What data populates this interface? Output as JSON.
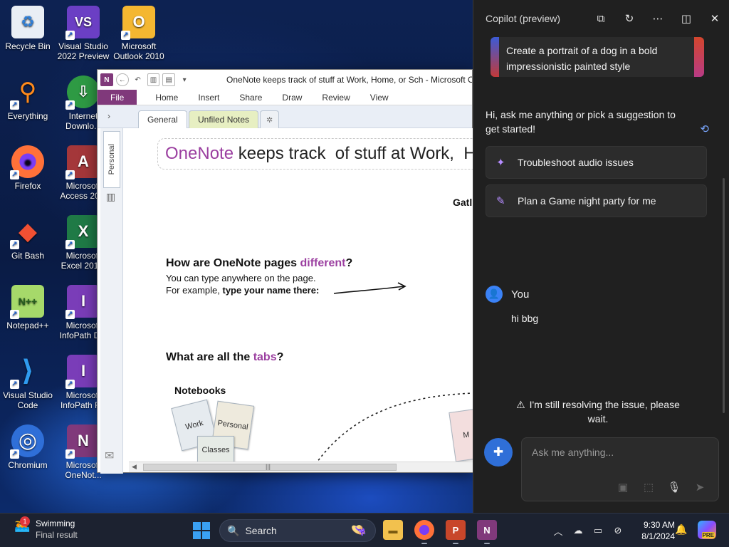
{
  "desktop": {
    "icons": [
      {
        "label": "Recycle Bin",
        "glyph": "♻",
        "bg": "#e9eef5",
        "fg": "#2f7fd8"
      },
      {
        "label": "Visual Studio 2022 Preview",
        "glyph": "VS",
        "bg": "#6b3fc4",
        "fg": "#ffffff"
      },
      {
        "label": "Microsoft Outlook 2010",
        "glyph": "O",
        "bg": "#f4b731",
        "fg": "#ffffff"
      },
      {
        "label": "Everything",
        "glyph": "⚲",
        "bg": "#1e2a48",
        "fg": "#ff8a1c"
      },
      {
        "label": "Internet Downlo...",
        "glyph": "⇩",
        "bg": "#2e9a44",
        "fg": "#ffffff"
      },
      {
        "label": "Firefox",
        "glyph": "●",
        "bg": "#ff7139",
        "fg": "#7a3df5"
      },
      {
        "label": "Microsoft Access 20...",
        "glyph": "A",
        "bg": "#a4373a",
        "fg": "#ffffff"
      },
      {
        "label": "Git Bash",
        "glyph": "◆",
        "bg": "#1e2a48",
        "fg": "#f05033"
      },
      {
        "label": "Microsoft Excel 201...",
        "glyph": "X",
        "bg": "#1f7a46",
        "fg": "#ffffff"
      },
      {
        "label": "Notepad++",
        "glyph": "N++",
        "bg": "#a6d96a",
        "fg": "#245c1e"
      },
      {
        "label": "Microsoft InfoPath D...",
        "glyph": "I",
        "bg": "#7a3db8",
        "fg": "#ffffff"
      },
      {
        "label": "Visual Studio Code",
        "glyph": "⟩",
        "bg": "#1e2a48",
        "fg": "#2f9bf0"
      },
      {
        "label": "Microsoft InfoPath F...",
        "glyph": "I",
        "bg": "#7a3db8",
        "fg": "#ffffff"
      },
      {
        "label": "Chromium",
        "glyph": "◎",
        "bg": "#2f6fd8",
        "fg": "#ffffff"
      },
      {
        "label": "Microsoft OneNot...",
        "glyph": "N",
        "bg": "#80397b",
        "fg": "#ffffff"
      }
    ]
  },
  "onenote": {
    "title": "OneNote keeps track of stuff at Work, Home, or Sch  -  Microsoft O",
    "ribbon_tabs": [
      "File",
      "Home",
      "Insert",
      "Share",
      "Draw",
      "Review",
      "View"
    ],
    "section_tabs": {
      "general": "General",
      "unfiled": "Unfiled Notes",
      "new": "✲"
    },
    "notebook_tab": "Personal",
    "page": {
      "title_a": "OneNote",
      "title_b": " keeps track  of stuff at Work,  H",
      "gather_fragment": "Gatl",
      "h_diff_a": "How are OneNote pages ",
      "h_diff_b": "different",
      "h_diff_c": "?",
      "line1": "You can  type anywhere on the page.",
      "line2_a": "For example, ",
      "line2_b": "type your name there:",
      "h_tabs_a": "What are all the ",
      "h_tabs_b": "tabs",
      "h_tabs_c": "?",
      "notebooks_label": "Notebooks",
      "nb_cards": [
        "Work",
        "Personal",
        "Classes"
      ],
      "right_card": "M"
    }
  },
  "copilot": {
    "title": "Copilot (preview)",
    "prompt_card": "Create a portrait of a dog in a bold impressionistic painted style",
    "greeting": "Hi, ask me anything or pick a suggestion to get started!",
    "suggestions": [
      {
        "icon": "✦",
        "label": "Troubleshoot audio issues"
      },
      {
        "icon": "✎",
        "label": "Plan a Game night party for me"
      }
    ],
    "user_label": "You",
    "user_message": "hi bbg",
    "status": "I'm still resolving the issue, please wait.",
    "input_placeholder": "Ask me anything..."
  },
  "taskbar": {
    "weather_title": "Swimming",
    "weather_sub": "Final result",
    "weather_badge": "1",
    "search_label": "Search",
    "time": "9:30 AM",
    "date": "8/1/2024",
    "copilot_badge": "PRE"
  },
  "colors": {
    "onenote_purple": "#80397b",
    "copilot_bg": "#202020",
    "accent_blue": "#2f6fd8"
  }
}
